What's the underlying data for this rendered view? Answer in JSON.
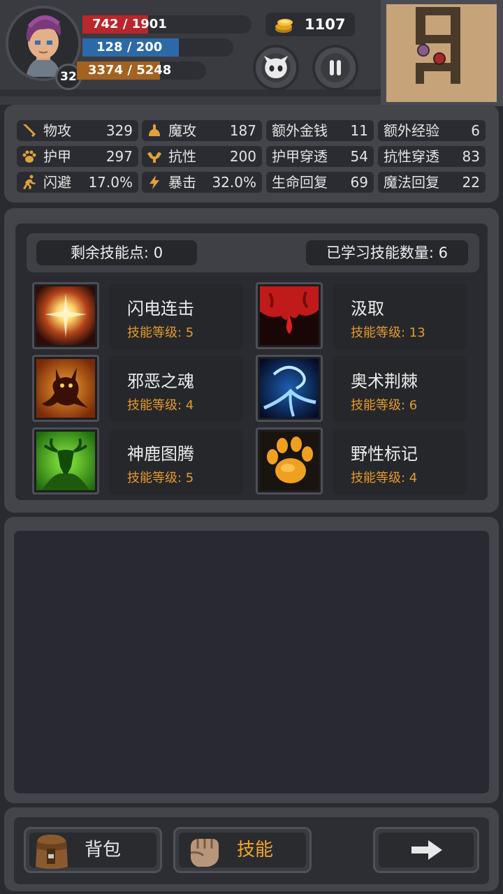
{
  "hud": {
    "level": "32",
    "hp": {
      "text": "742 / 1901",
      "current": 742,
      "max": 1901
    },
    "mp": {
      "text": "128 / 200",
      "current": 128,
      "max": 200
    },
    "xp": {
      "text": "3374 / 5248",
      "current": 3374,
      "max": 5248
    },
    "gold": "1107",
    "icons": [
      "avatar",
      "gold-coin-icon",
      "monster-face-icon",
      "pause-icon",
      "minimap"
    ]
  },
  "stats": [
    {
      "label": "物攻",
      "value": "329",
      "icon": "sword-icon"
    },
    {
      "label": "魔攻",
      "value": "187",
      "icon": "magic-hand-icon"
    },
    {
      "label": "额外金钱",
      "value": "11"
    },
    {
      "label": "额外经验",
      "value": "6"
    },
    {
      "label": "护甲",
      "value": "297",
      "icon": "paw-icon"
    },
    {
      "label": "抗性",
      "value": "200",
      "icon": "flex-arm-icon"
    },
    {
      "label": "护甲穿透",
      "value": "54"
    },
    {
      "label": "抗性穿透",
      "value": "83"
    },
    {
      "label": "闪避",
      "value": "17.0%",
      "icon": "running-man-icon"
    },
    {
      "label": "暴击",
      "value": "32.0%",
      "icon": "lightning-icon"
    },
    {
      "label": "生命回复",
      "value": "69"
    },
    {
      "label": "魔法回复",
      "value": "22"
    }
  ],
  "skills_panel": {
    "remaining_points": "剩余技能点: 0",
    "learned_count": "已学习技能数量: 6",
    "skills": [
      {
        "name": "闪电连击",
        "level": "技能等级: 5",
        "icon": "light-burst-icon"
      },
      {
        "name": "汲取",
        "level": "技能等级: 13",
        "icon": "blood-drain-icon"
      },
      {
        "name": "邪恶之魂",
        "level": "技能等级: 4",
        "icon": "evil-soul-icon"
      },
      {
        "name": "奥术荆棘",
        "level": "技能等级: 6",
        "icon": "arcane-thorn-icon"
      },
      {
        "name": "神鹿图腾",
        "level": "技能等级: 5",
        "icon": "deer-totem-icon"
      },
      {
        "name": "野性标记",
        "level": "技能等级: 4",
        "icon": "paw-mark-icon"
      }
    ]
  },
  "bottom": {
    "bag": "背包",
    "skills": "技能",
    "colors": {
      "active_tab": "#f0a62d",
      "level_text": "#e59b2a"
    }
  }
}
